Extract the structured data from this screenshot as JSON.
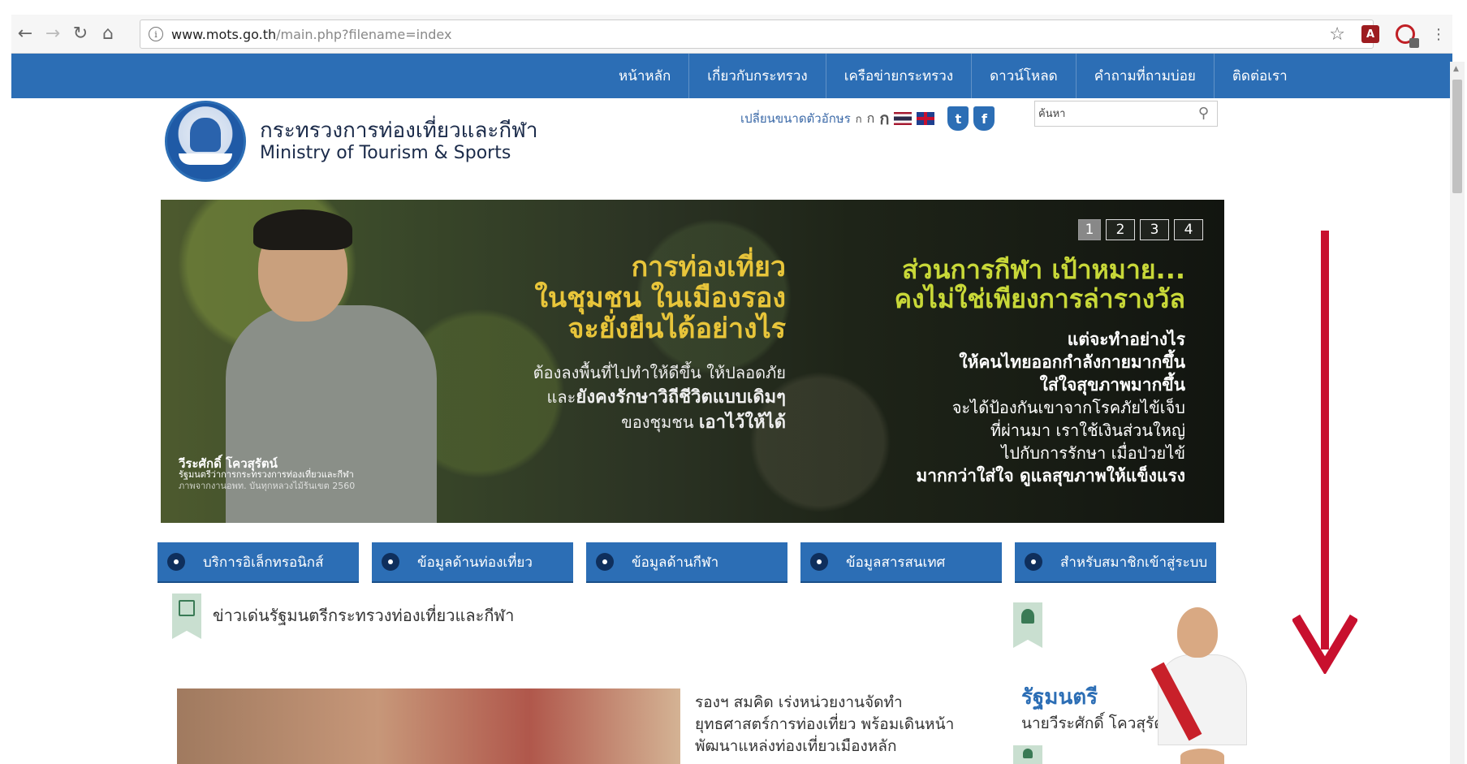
{
  "browser": {
    "url_host": "www.mots.go.th",
    "url_path": "/main.php?filename=index"
  },
  "top_nav": {
    "items": [
      "หน้าหลัก",
      "เกี่ยวกับกระทรวง",
      "เครือข่ายกระทรวง",
      "ดาวน์โหลด",
      "คำถามที่ถามบ่อย",
      "ติดต่อเรา"
    ]
  },
  "header": {
    "org_name_th": "กระทรวงการท่องเที่ยวและกีฬา",
    "org_name_en": "Ministry of Tourism & Sports",
    "font_size_label": "เปลี่ยนขนาดตัวอักษร",
    "font_sizes": [
      "ก",
      "ก",
      "ก"
    ],
    "search_placeholder": "ค้นหา"
  },
  "banner": {
    "slides": [
      "1",
      "2",
      "3",
      "4"
    ],
    "active_slide": "1",
    "left_headline": [
      "การท่องเที่ยว",
      "ในชุมชน ในเมืองรอง",
      "จะยั่งยืนได้อย่างไร"
    ],
    "left_sub_1": "ต้องลงพื้นที่ไปทำให้ดีขึ้น ให้ปลอดภัย",
    "left_sub_2_prefix": "และ",
    "left_sub_2_bold": "ยังคงรักษาวิถีชีวิตแบบเดิมๆ",
    "left_sub_3_prefix": "ของชุมชน",
    "left_sub_3_bold": "เอาไว้ให้ได้",
    "right_headline": [
      "ส่วนการกีฬา เป้าหมาย...",
      "คงไม่ใช่เพียงการล่ารางวัล"
    ],
    "right_sub_bold_1": "แต่จะทำอย่างไร",
    "right_sub_bold_2": "ให้คนไทยออกกำลังกายมากขึ้น",
    "right_sub_bold_3": "ใส่ใจสุขภาพมากขึ้น",
    "right_sub_4": "จะได้ป้องกันเขาจากโรคภัยไข้เจ็บ",
    "right_sub_5": "ที่ผ่านมา เราใช้เงินส่วนใหญ่",
    "right_sub_6": "ไปกับการรักษา เมื่อป่วยไข้",
    "right_sub_bold_7": "มากกว่าใส่ใจ ดูแลสุขภาพให้แข็งแรง",
    "caption_name": "วีระศักดิ์ โควสุรัตน์",
    "caption_title": "รัฐมนตรีว่าการกระทรวงการท่องเที่ยวและกีฬา",
    "caption_credit": "ภาพจากงานอพท. บันทุกหลวงไม้ร้นเขต 2560"
  },
  "quick_nav": [
    "บริการอิเล็กทรอนิกส์",
    "ข้อมูลด้านท่องเที่ยว",
    "ข้อมูลด้านกีฬา",
    "ข้อมูลสารสนเทศ",
    "สำหรับสมาชิกเข้าสู่ระบบ"
  ],
  "news": {
    "heading": "ข่าวเด่นรัฐมนตรีกระทรวงท่องเที่ยวและกีฬา",
    "item_text": "รองฯ สมคิด เร่งหน่วยงานจัดทำยุทธศาสตร์การท่องเที่ยว พร้อมเดินหน้าพัฒนาแหล่งท่องเที่ยวเมืองหลัก"
  },
  "minister": {
    "title": "รัฐมนตรี",
    "name": "นายวีระศักดิ์ โควสุรัตน์"
  },
  "colors": {
    "brand_blue": "#2c6eb5",
    "annotation_red": "#c8102e"
  }
}
